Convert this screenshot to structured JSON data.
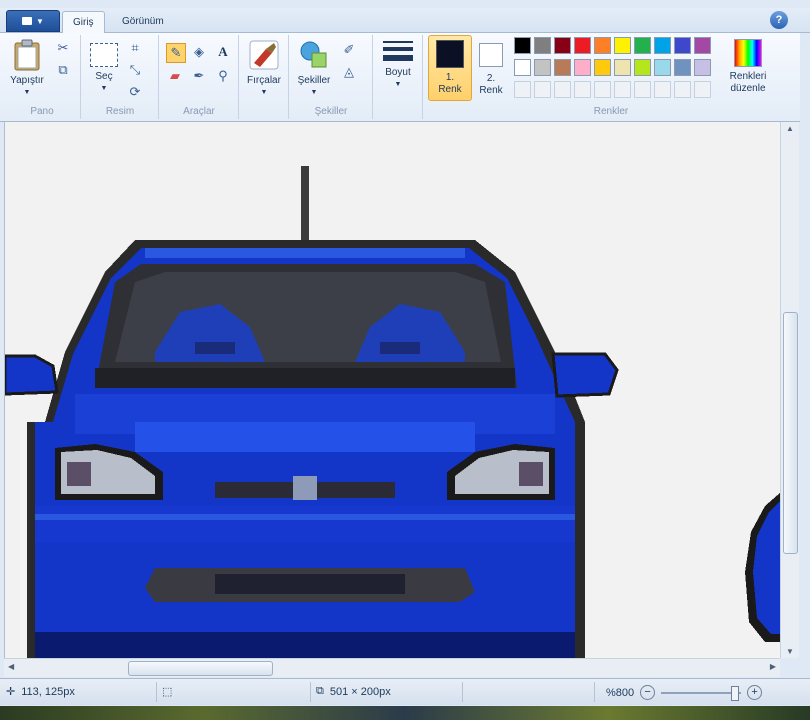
{
  "tabs": [
    {
      "label": "Giriş",
      "active": true
    },
    {
      "label": "Görünüm",
      "active": false
    }
  ],
  "app_menu_icon": "paint-menu-icon",
  "groups": {
    "pano": {
      "label": "Pano",
      "paste_label": "Yapıştır"
    },
    "resim": {
      "label": "Resim",
      "select_label": "Seç"
    },
    "araclar": {
      "label": "Araçlar",
      "text_tool": "A"
    },
    "fircalar": {
      "label": "Fırçalar"
    },
    "sekiller": {
      "label": "Şekiller",
      "shapes_label": "Şekiller"
    },
    "boyut": {
      "label": "Boyut"
    },
    "renkler": {
      "label": "Renkler",
      "color1_line1": "1.",
      "color1_line2": "Renk",
      "color2_line1": "2.",
      "color2_line2": "Renk",
      "edit_line1": "Renkleri",
      "edit_line2": "düzenle",
      "color1": "#0b1024",
      "color2": "#ffffff",
      "palette_row1": [
        "#000000",
        "#7f7f7f",
        "#880015",
        "#ed1c24",
        "#ff7f27",
        "#fff200",
        "#22b14c",
        "#00a2e8",
        "#3f48cc",
        "#a349a4"
      ],
      "palette_row2": [
        "#ffffff",
        "#c3c3c3",
        "#b97a57",
        "#ffaec9",
        "#ffc90e",
        "#efe4b0",
        "#b5e61d",
        "#99d9ea",
        "#7092be",
        "#c8bfe7"
      ]
    }
  },
  "status": {
    "cursor_pos": "113, 125px",
    "image_size": "501 × 200px",
    "zoom": "%800"
  },
  "colors": {
    "car_blue": "#1436c8",
    "car_dark": "#0a1a6e",
    "canvas_bg": "#f2f2f2",
    "window_dark": "#2e3036"
  }
}
